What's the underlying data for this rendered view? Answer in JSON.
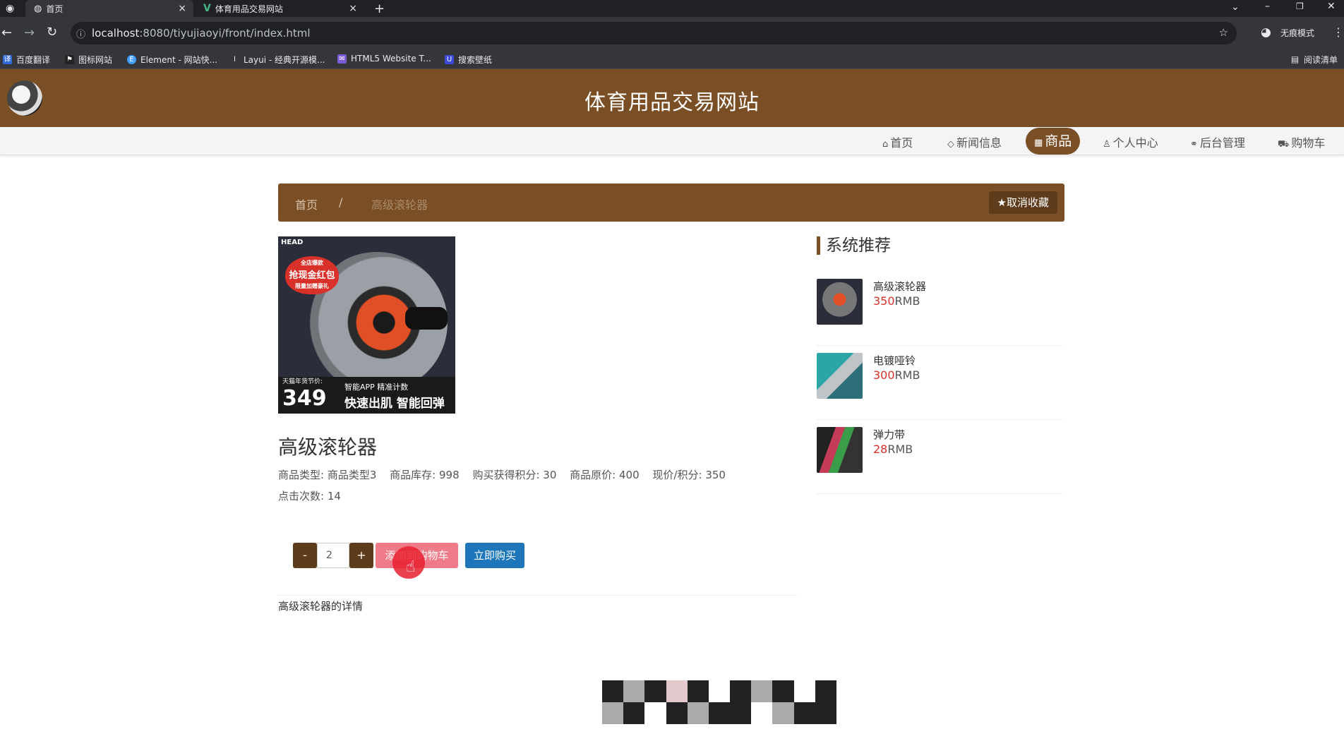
{
  "browser": {
    "tabs": [
      {
        "label": "首页",
        "active": true
      },
      {
        "label": "体育用品交易网站",
        "active": false
      }
    ],
    "url_host": "localhost",
    "url_path": ":8080/tiyujiaoyi/front/index.html",
    "profile_label": "无痕模式",
    "bookmarks": [
      "百度翻译",
      "图标网站",
      "Element - 网站快...",
      "Layui - 经典开源模...",
      "HTML5 Website T...",
      "搜索壁纸"
    ],
    "reading_list": "阅读清单"
  },
  "site": {
    "title": "体育用品交易网站",
    "nav": [
      "首页",
      "新闻信息",
      "商品",
      "个人中心",
      "后台管理",
      "购物车"
    ],
    "active_nav": "商品",
    "accent": "#7b4f25"
  },
  "breadcrumb": {
    "home": "首页",
    "separator": "/",
    "current": "高级滚轮器",
    "favorite_button": "取消收藏"
  },
  "product": {
    "name": "高级滚轮器",
    "image": {
      "brand": "HEAD",
      "badge_top": "全店爆款",
      "badge_main": "抢现金红包",
      "badge_sub": "限量加赠豪礼",
      "price_label": "天猫年货节价:",
      "price": "349",
      "feature": "智能APP 精准计数",
      "slogan": "快速出肌 智能回弹"
    },
    "attributes": [
      {
        "label": "商品类型:",
        "value": "商品类型3"
      },
      {
        "label": "商品库存:",
        "value": "998"
      },
      {
        "label": "购买获得积分:",
        "value": "30"
      },
      {
        "label": "商品原价:",
        "value": "400"
      },
      {
        "label": "现价/积分:",
        "value": "350"
      },
      {
        "label": "点击次数:",
        "value": "14"
      }
    ],
    "quantity": "2",
    "minus_label": "-",
    "plus_label": "+",
    "add_to_cart": "添加到购物车",
    "buy_now": "立即购买",
    "detail": "高级滚轮器的详情"
  },
  "recommend": {
    "title": "系统推荐",
    "items": [
      {
        "name": "高级滚轮器",
        "price": "350",
        "unit": "RMB"
      },
      {
        "name": "电镀哑铃",
        "price": "300",
        "unit": "RMB"
      },
      {
        "name": "弹力带",
        "price": "28",
        "unit": "RMB"
      }
    ]
  }
}
